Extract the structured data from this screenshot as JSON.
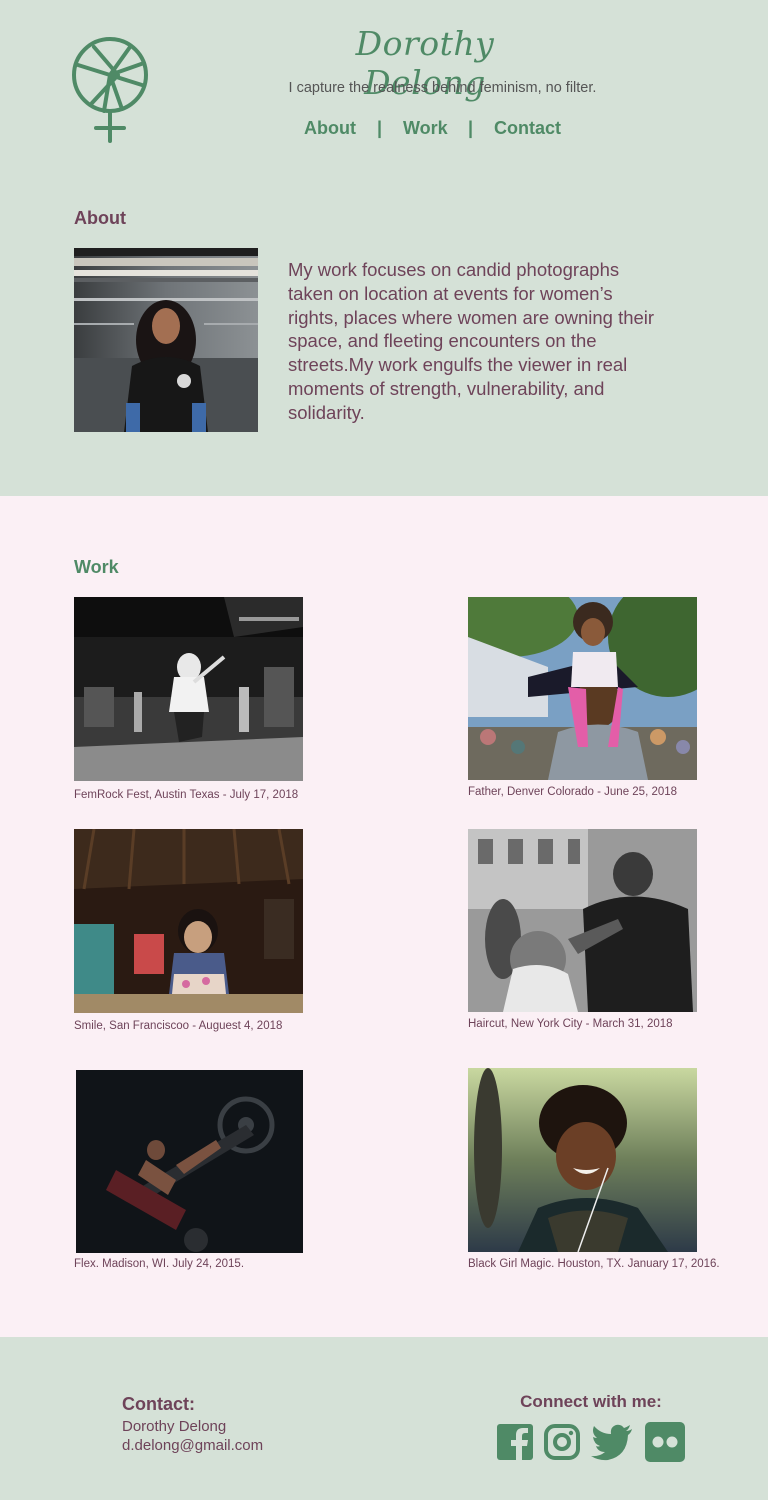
{
  "header": {
    "site_title": "Dorothy Delong",
    "tagline": "I capture the realness behind feminism, no filter.",
    "nav": [
      {
        "label": "About"
      },
      {
        "label": "Work"
      },
      {
        "label": "Contact"
      }
    ],
    "nav_separator": "|",
    "logo_icon": "camera-aperture-venus-logo"
  },
  "about": {
    "heading": "About",
    "photo_icon": "portrait-photo",
    "text": "My work focuses on candid photographs taken on location at events for women’s rights, places where women are owning their space, and fleeting encounters on the streets.My work engulfs the viewer in real moments of strength, vulnerability, and solidarity."
  },
  "work": {
    "heading": "Work",
    "items": [
      {
        "caption": "FemRock Fest, Austin Texas - July 17, 2018",
        "icon": "concert-photo"
      },
      {
        "caption": "Father, Denver Colorado - June 25, 2018",
        "icon": "father-daughter-photo"
      },
      {
        "caption": "Smile, San Franciscoo - Auguest 4, 2018",
        "icon": "child-smile-photo"
      },
      {
        "caption": "Haircut, New York City - March 31, 2018",
        "icon": "haircut-photo"
      },
      {
        "caption": "Flex. Madison, WI. July 24, 2015.",
        "icon": "gym-photo"
      },
      {
        "caption": "Black Girl Magic. Houston, TX. January 17, 2016.",
        "icon": "woman-laughing-photo"
      }
    ]
  },
  "footer": {
    "contact_label": "Contact:",
    "contact_name": "Dorothy Delong",
    "contact_email": "d.delong@gmail.com",
    "connect_label": "Connect with me:",
    "social": [
      "facebook-icon",
      "instagram-icon",
      "twitter-icon",
      "flickr-icon"
    ]
  },
  "colors": {
    "green": "#4f8a66",
    "plum": "#6e4359",
    "header_bg": "#d5e1d7",
    "work_bg": "#fbf0f5"
  }
}
